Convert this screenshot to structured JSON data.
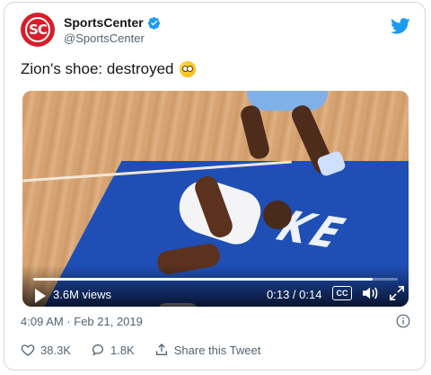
{
  "account": {
    "display_name": "SportsCenter",
    "handle": "@SportsCenter",
    "avatar_text": "SC",
    "verified": true
  },
  "tweet": {
    "text": "Zion's shoe: destroyed",
    "emoji": "flushed-face"
  },
  "video": {
    "views": "3.6M views",
    "timecode": "0:13 / 0:14",
    "cc_label": "CC",
    "progress": 0.93,
    "court_text": "KE"
  },
  "meta": {
    "timestamp": "4:09 AM · Feb 21, 2019"
  },
  "actions": {
    "likes": "38.3K",
    "replies": "1.8K",
    "share_label": "Share this Tweet"
  },
  "colors": {
    "brand_red": "#d81e2a",
    "twitter_blue": "#1d9bf0",
    "muted_text": "#536471",
    "court_blue": "#1f4fb5"
  }
}
